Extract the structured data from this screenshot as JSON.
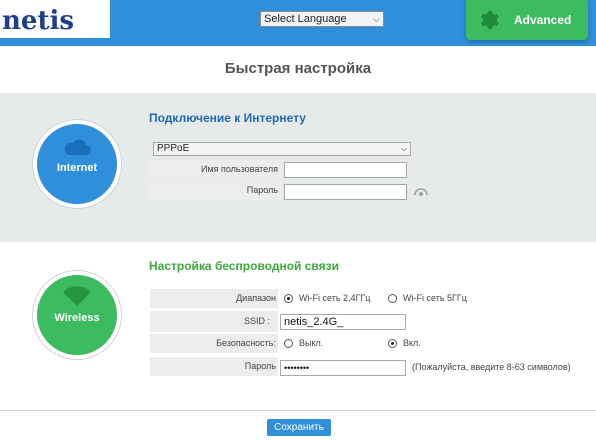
{
  "header": {
    "logo": "netis",
    "language_select": "Select Language",
    "advanced_label": "Advanced"
  },
  "page_title": "Быстрая настройка",
  "internet": {
    "circle_label": "Internet",
    "section_title": "Подключение к Интернету",
    "connection_type": "PPPoE",
    "username_label": "Имя пользователя",
    "username_value": "",
    "password_label": "Пароль",
    "password_value": ""
  },
  "wireless": {
    "circle_label": "Wireless",
    "section_title": "Настройка беспроводной связи",
    "band_label": "Диапазон",
    "band_options": [
      "Wi-Fi сеть 2,4ГГц",
      "Wi-Fi сеть 5ГГц"
    ],
    "band_selected": "Wi-Fi сеть 2,4ГГц",
    "ssid_label": "SSID :",
    "ssid_value": "netis_2.4G_",
    "security_label": "Безопасность:",
    "security_options": [
      "Выкл.",
      "Вкл."
    ],
    "security_selected": "Вкл.",
    "password_label": "Пароль",
    "password_value": "••••••••",
    "password_hint": "(Пожалуйста, введите 8-63 символов)"
  },
  "save_label": "Сохранить",
  "colors": {
    "header_blue": "#2f8fdc",
    "accent_green": "#3dbb61",
    "logo_navy": "#1f3f8a"
  }
}
